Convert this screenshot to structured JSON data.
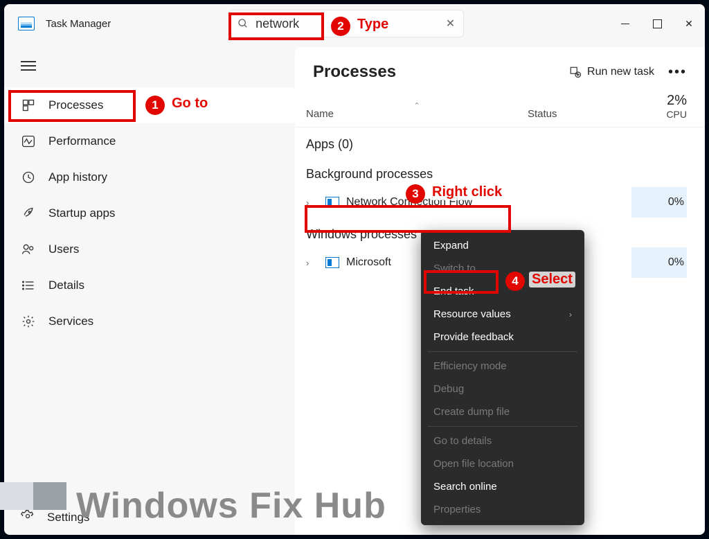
{
  "app": {
    "title": "Task Manager"
  },
  "search": {
    "value": "network"
  },
  "win_controls": {
    "min": "–",
    "max": "▢",
    "close": "✕"
  },
  "sidebar": {
    "items": [
      {
        "label": "Processes",
        "icon": "grid-icon",
        "active": true
      },
      {
        "label": "Performance",
        "icon": "activity-icon",
        "active": false
      },
      {
        "label": "App history",
        "icon": "history-icon",
        "active": false
      },
      {
        "label": "Startup apps",
        "icon": "rocket-icon",
        "active": false
      },
      {
        "label": "Users",
        "icon": "users-icon",
        "active": false
      },
      {
        "label": "Details",
        "icon": "list-icon",
        "active": false
      },
      {
        "label": "Services",
        "icon": "gear-icon",
        "active": false
      }
    ],
    "settings_label": "Settings"
  },
  "main": {
    "heading": "Processes",
    "run_new_task": "Run new task",
    "columns": {
      "name": "Name",
      "status": "Status",
      "cpu_pct": "2%",
      "cpu_label": "CPU"
    },
    "groups": [
      {
        "title": "Apps (0)",
        "rows": []
      },
      {
        "title": "Background processes",
        "rows": [
          {
            "name": "Network Connection Flow",
            "cpu": "0%"
          }
        ]
      },
      {
        "title": "Windows processes",
        "rows": [
          {
            "name": "Microsoft",
            "cpu": "0%"
          }
        ]
      }
    ]
  },
  "ctx": {
    "items": [
      {
        "label": "Expand",
        "enabled": true
      },
      {
        "label": "Switch to",
        "enabled": false
      },
      {
        "label": "End task",
        "enabled": true
      },
      {
        "label": "Resource values",
        "enabled": true,
        "submenu": true
      },
      {
        "label": "Provide feedback",
        "enabled": true
      },
      {
        "sep": true
      },
      {
        "label": "Efficiency mode",
        "enabled": false
      },
      {
        "label": "Debug",
        "enabled": false
      },
      {
        "label": "Create dump file",
        "enabled": false
      },
      {
        "sep": true
      },
      {
        "label": "Go to details",
        "enabled": false
      },
      {
        "label": "Open file location",
        "enabled": false
      },
      {
        "label": "Search online",
        "enabled": true
      },
      {
        "label": "Properties",
        "enabled": false
      }
    ]
  },
  "annotations": {
    "step1": "Go to",
    "step2": "Type",
    "step3": "Right click",
    "step4": "Select"
  },
  "watermark": "Windows Fix Hub"
}
